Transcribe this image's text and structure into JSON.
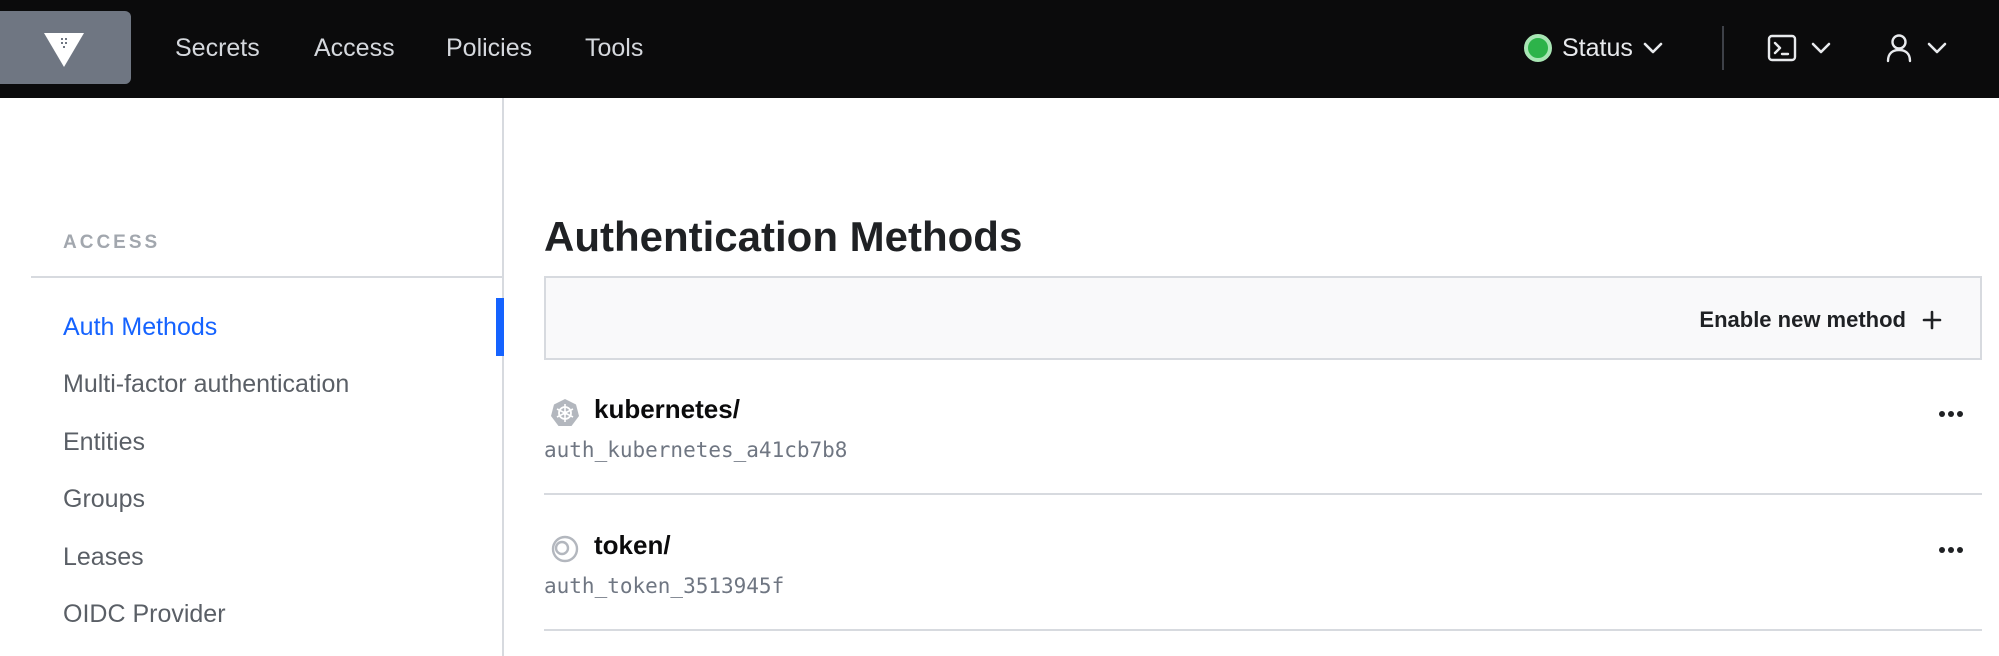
{
  "header": {
    "nav": [
      {
        "label": "Secrets"
      },
      {
        "label": "Access"
      },
      {
        "label": "Policies"
      },
      {
        "label": "Tools"
      }
    ],
    "status_label": "Status"
  },
  "sidebar": {
    "heading": "ACCESS",
    "items": [
      {
        "label": "Auth Methods",
        "active": true
      },
      {
        "label": "Multi-factor authentication"
      },
      {
        "label": "Entities"
      },
      {
        "label": "Groups"
      },
      {
        "label": "Leases"
      },
      {
        "label": "OIDC Provider"
      }
    ]
  },
  "main": {
    "title": "Authentication Methods",
    "enable_label": "Enable new method",
    "methods": [
      {
        "path": "kubernetes/",
        "accessor": "auth_kubernetes_a41cb7b8",
        "icon": "kubernetes-icon"
      },
      {
        "path": "token/",
        "accessor": "auth_token_3513945f",
        "icon": "token-icon"
      }
    ]
  },
  "colors": {
    "accent": "#1563ff",
    "status": "#2db34a",
    "topbar": "#0b0b0c"
  }
}
